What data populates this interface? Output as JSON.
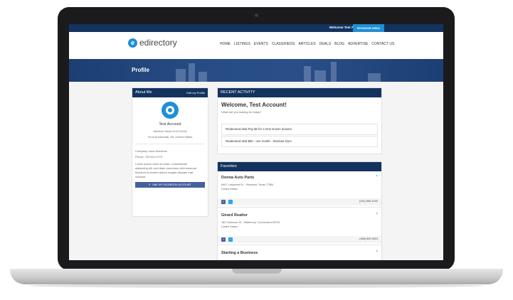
{
  "topbar": {
    "welcome": "Welcome Test Account Demo ▾",
    "sponsor": "SPONSOR AREA"
  },
  "brand": {
    "logo_letter": "e",
    "name": "edirectory"
  },
  "nav": [
    "HOME",
    "LISTINGS",
    "EVENTS",
    "CLASSIFIEDS",
    "ARTICLES",
    "DEALS",
    "BLOG",
    "ADVERTISE",
    "CONTACT US"
  ],
  "hero": {
    "title": "Profile"
  },
  "about": {
    "title": "About Me",
    "edit": "Edit my Profile",
    "name": "Test Account",
    "member_since": "Member Since 01/27/2018",
    "location": "From Annandale, VA, United States",
    "company": "Company: Arca Solutions",
    "phone": "Phone: 703.914.0770",
    "bio_lines": [
      "Lorem ipsum dolor sit amet, consectetuer",
      "adipiscing elit, sed diam nonummy nibh euismod",
      "tincidunt ut laoreet dolore magna aliquam erat",
      "volutpat."
    ],
    "facebook_button": "LINK MY FACEBOOK ACCOUNT"
  },
  "activity": {
    "title": "RECENT ACTIVITY",
    "welcome": "Welcome, Test Account!",
    "prompt": "What are you looking for today?",
    "items": [
      "Redeemed deal Pay $3 for a One Dozen donuts!",
      "Redeemed deal $50 - one month - Workout Gym"
    ]
  },
  "favorites": {
    "title": "Favorites",
    "items": [
      {
        "name": "Donna Auto Parts",
        "address": "8407 Larrycrest Dr , Pearland, Texas 77584",
        "country": "United States",
        "phone": "(231) 855-4232"
      },
      {
        "name": "Girard Realtor",
        "address": "182 Cushman St , Waterbury, Connecticut 06704",
        "country": "United States",
        "phone": "(456) 895 5823"
      },
      {
        "name": "Starting a Business",
        "address": "",
        "country": "",
        "phone": ""
      }
    ],
    "close_glyph": "×"
  },
  "colors": {
    "navy": "#13335f",
    "accent": "#1f8fd6",
    "facebook": "#45619d",
    "twitter": "#1da1f2"
  }
}
